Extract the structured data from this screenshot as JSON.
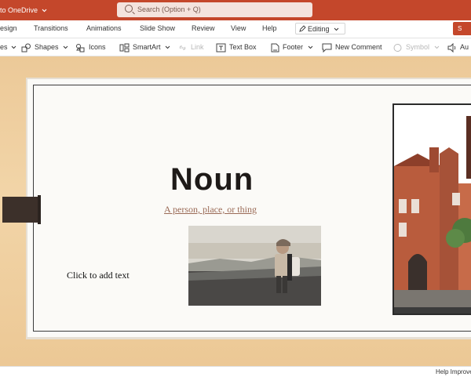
{
  "titlebar": {
    "saved_status": "to OneDrive",
    "search_placeholder": "Search (Option + Q)",
    "share_label": "S"
  },
  "menu": {
    "tabs": [
      "esign",
      "Transitions",
      "Animations",
      "Slide Show",
      "Review",
      "View",
      "Help"
    ],
    "editing_label": "Editing"
  },
  "toolbar": {
    "items": {
      "images": "es",
      "shapes": "Shapes",
      "icons": "Icons",
      "smartart": "SmartArt",
      "link": "Link",
      "textbox": "Text Box",
      "footer": "Footer",
      "comment": "New Comment",
      "symbol": "Symbol",
      "audio": "Au"
    }
  },
  "slide": {
    "title": "Noun",
    "definition": "A person, place, or thing",
    "placeholder": "Click to add text"
  },
  "status": {
    "help_text": "Help Improve"
  },
  "colors": {
    "brand": "#c4472b",
    "workspace": "#f0d2a4"
  }
}
